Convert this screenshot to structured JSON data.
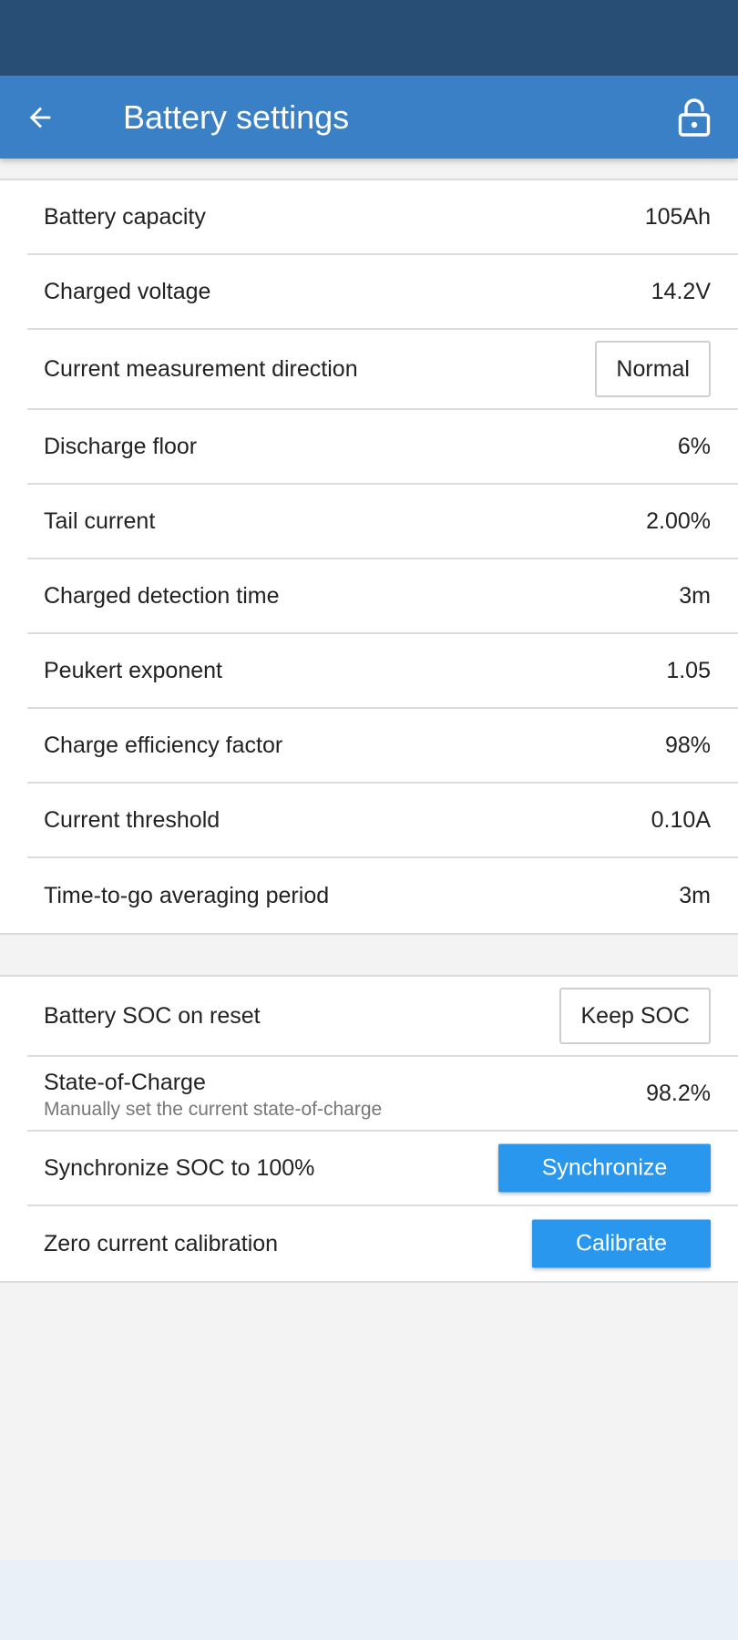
{
  "app_bar": {
    "title": "Battery settings",
    "back_icon": "arrow-left-icon",
    "lock_icon": "lock-open-icon"
  },
  "colors": {
    "status_bar": "#294e76",
    "app_bar": "#3a80c7",
    "accent_button": "#2a97ee"
  },
  "settings": [
    {
      "label": "Battery capacity",
      "value": "105Ah"
    },
    {
      "label": "Charged voltage",
      "value": "14.2V"
    },
    {
      "label": "Current measurement direction",
      "value": "Normal"
    },
    {
      "label": "Discharge floor",
      "value": "6%"
    },
    {
      "label": "Tail current",
      "value": "2.00%"
    },
    {
      "label": "Charged detection time",
      "value": "3m"
    },
    {
      "label": "Peukert exponent",
      "value": "1.05"
    },
    {
      "label": "Charge efficiency factor",
      "value": "98%"
    },
    {
      "label": "Current threshold",
      "value": "0.10A"
    },
    {
      "label": "Time-to-go averaging period",
      "value": "3m"
    }
  ],
  "soc": {
    "reset": {
      "label": "Battery SOC on reset",
      "value": "Keep SOC"
    },
    "state": {
      "label": "State-of-Charge",
      "sublabel": "Manually set the current state-of-charge",
      "value": "98.2%"
    },
    "sync": {
      "label": "Synchronize SOC to 100%",
      "button": "Synchronize"
    },
    "calibration": {
      "label": "Zero current calibration",
      "button": "Calibrate"
    }
  }
}
